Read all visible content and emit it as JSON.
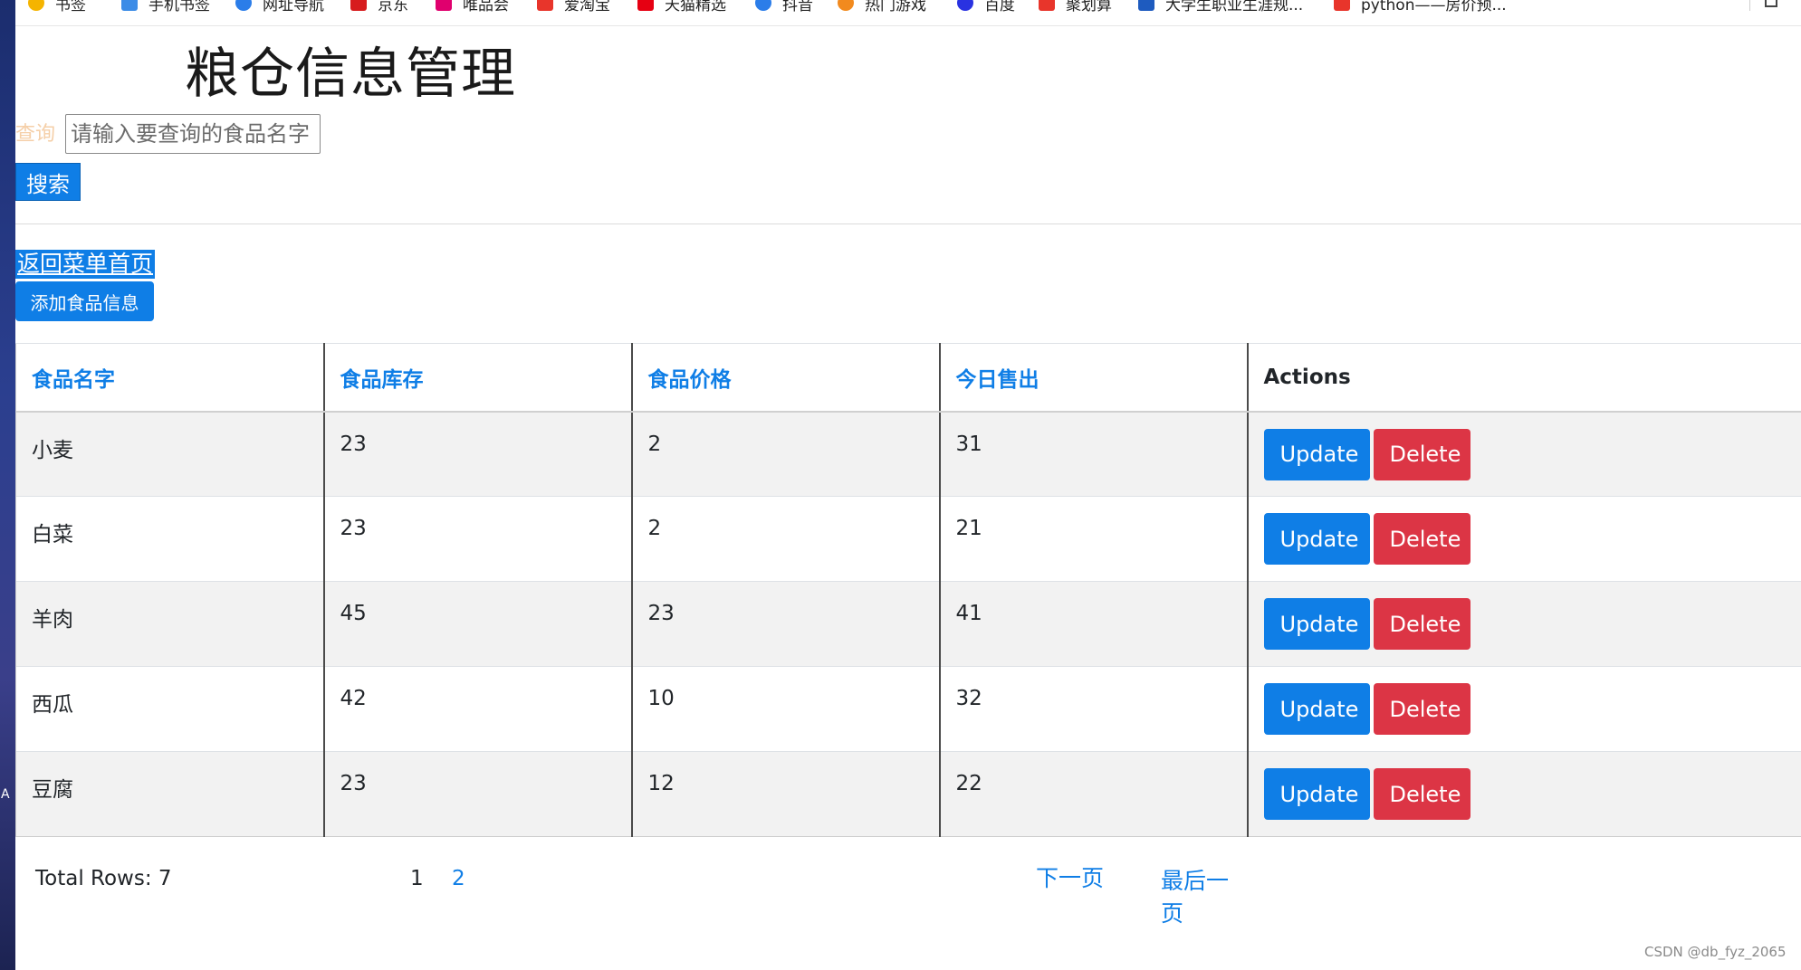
{
  "bookmarks": [
    {
      "label": "书签",
      "icon": "star-icon",
      "color": "#f5b400"
    },
    {
      "label": "手机书签",
      "icon": "phone-icon",
      "color": "#3c8ce7"
    },
    {
      "label": "网址导航",
      "icon": "ie-icon",
      "color": "#2b7de9"
    },
    {
      "label": "京东",
      "icon": "jd-logo-icon",
      "color": "#d71c1e"
    },
    {
      "label": "唯品会",
      "icon": "vip-logo-icon",
      "color": "#e0006e"
    },
    {
      "label": "爱淘宝",
      "icon": "taobao-logo-icon",
      "color": "#e8352b"
    },
    {
      "label": "天猫精选",
      "icon": "tmall-logo-icon",
      "color": "#e60012"
    },
    {
      "label": "抖音",
      "icon": "ie-icon",
      "color": "#2b7de9"
    },
    {
      "label": "热门游戏",
      "icon": "game-icon",
      "color": "#f28a1e"
    },
    {
      "label": "百度",
      "icon": "baidu-logo-icon",
      "color": "#2932e1"
    },
    {
      "label": "聚划算",
      "icon": "juhuasuan-logo-icon",
      "color": "#e8352b"
    },
    {
      "label": "大学生职业生涯规...",
      "icon": "pc-logo-icon",
      "color": "#1e5bbf"
    },
    {
      "label": "python——房价预...",
      "icon": "page-icon",
      "color": "#e8352b"
    }
  ],
  "header": {
    "title": "粮仓信息管理"
  },
  "search": {
    "label": "查询",
    "placeholder": "请输入要查询的食品名字",
    "value": "",
    "button_label": "搜索"
  },
  "nav": {
    "back_label": "返回菜单首页",
    "add_label": "添加食品信息"
  },
  "table": {
    "columns": [
      "食品名字",
      "食品库存",
      "食品价格",
      "今日售出",
      "Actions"
    ],
    "rows": [
      {
        "name": "小麦",
        "stock": "23",
        "price": "2",
        "sold": "31"
      },
      {
        "name": "白菜",
        "stock": "23",
        "price": "2",
        "sold": "21"
      },
      {
        "name": "羊肉",
        "stock": "45",
        "price": "23",
        "sold": "41"
      },
      {
        "name": "西瓜",
        "stock": "42",
        "price": "10",
        "sold": "32"
      },
      {
        "name": "豆腐",
        "stock": "23",
        "price": "12",
        "sold": "22"
      }
    ],
    "update_label": "Update",
    "delete_label": "Delete"
  },
  "pagination": {
    "total_rows": "Total Rows: 7",
    "current_page": "1",
    "other_page": "2",
    "next_label": "下一页",
    "last_label": "最后一页"
  },
  "colors": {
    "primary": "#0f7ee6",
    "danger": "#dc3545",
    "query_label": "#f5cfa8"
  },
  "watermark": "CSDN @db_fyz_2065"
}
